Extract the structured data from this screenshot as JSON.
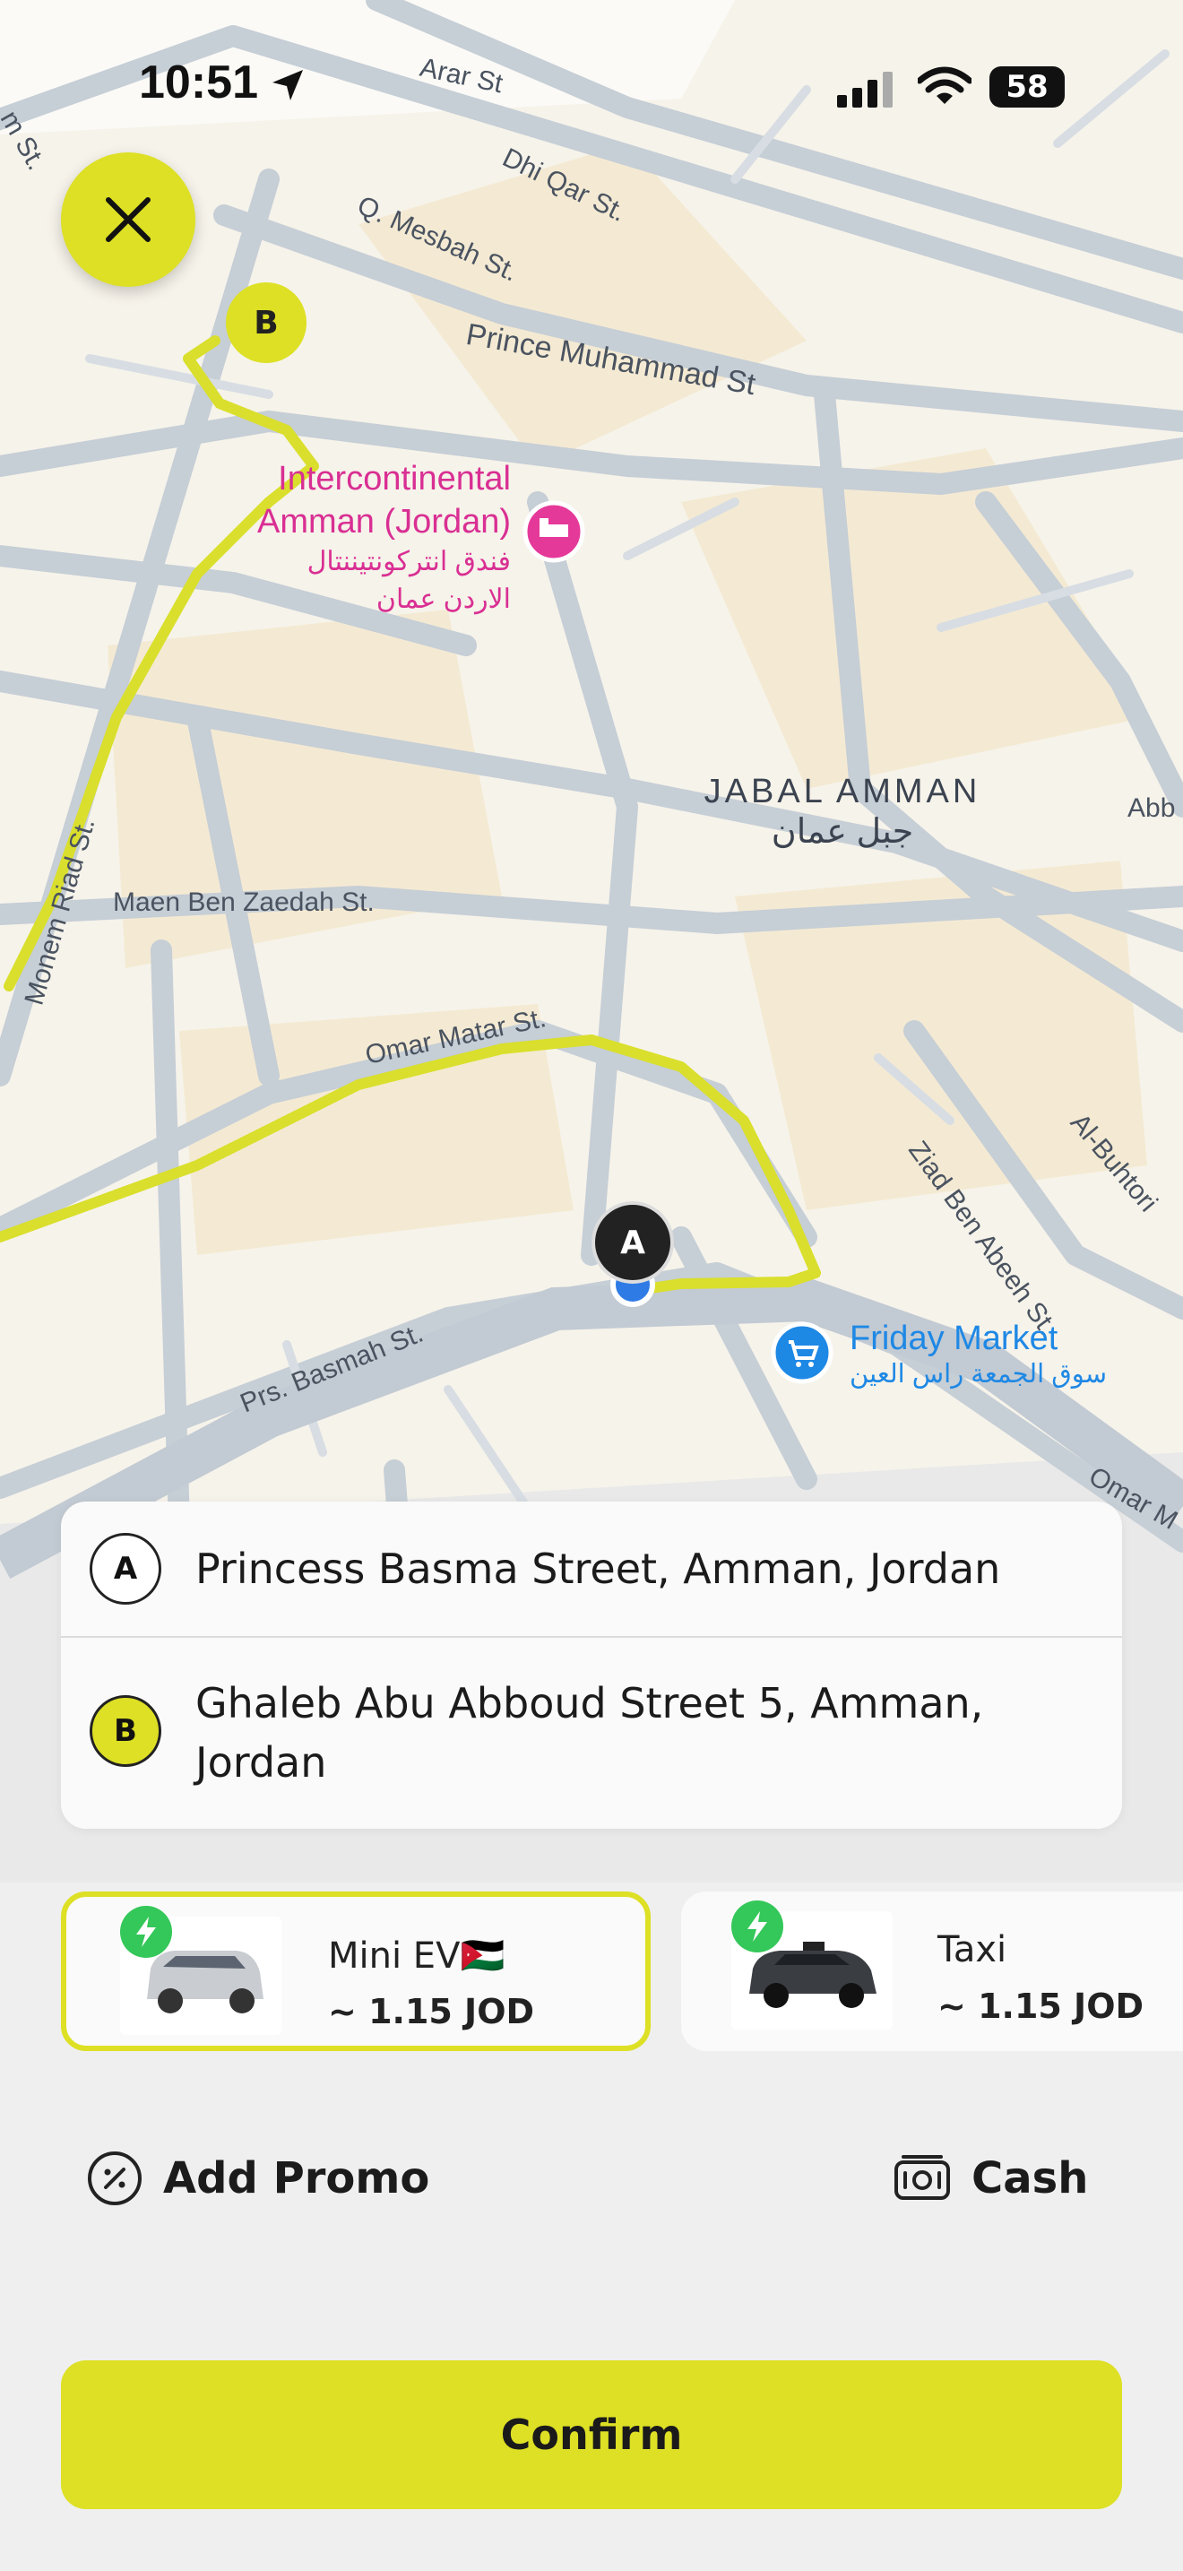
{
  "status_bar": {
    "time": "10:51",
    "battery": "58"
  },
  "map": {
    "streets": {
      "arar": "Arar St",
      "dhi_qar": "Dhi Qar St.",
      "q_mesbah": "Q. Mesbah St.",
      "prince_muhammad": "Prince Muhammad St",
      "monem_riad": "Monem Riad St.",
      "maen": "Maen Ben Zaedah St.",
      "omar_matar": "Omar Matar St.",
      "basmah": "Prs. Basmah St.",
      "ziad": "Ziad Ben Abeeh St.",
      "al_buhtori": "Al-Buhtori",
      "omar_m": "Omar M",
      "abb": "Abb",
      "m_st": "m St."
    },
    "hotel": {
      "line1": "Intercontinental",
      "line2": "Amman (Jordan)",
      "ar_line1": "فندق انتركونتيننتال",
      "ar_line2": "الاردن عمان"
    },
    "district": {
      "en": "JABAL AMMAN",
      "ar": "جبل عمان"
    },
    "market": {
      "en": "Friday Market",
      "ar": "سوق الجمعة راس العين"
    },
    "pin_a": "A",
    "pin_b": "B"
  },
  "route_card": {
    "pickup": {
      "marker": "A",
      "address": "Princess Basma Street, Amman, Jordan"
    },
    "dropoff": {
      "marker": "B",
      "address": "Ghaleb Abu Abboud Street 5, Amman, Jordan"
    }
  },
  "rides": [
    {
      "name": "Mini EV🇯🇴",
      "price": "~ 1.15 JOD",
      "selected": true
    },
    {
      "name": "Taxi",
      "price": "~ 1.15 JOD",
      "selected": false
    }
  ],
  "options": {
    "promo": "Add Promo",
    "payment": "Cash"
  },
  "confirm": "Confirm",
  "colors": {
    "accent": "#dde024",
    "route": "#d9df2c",
    "hotel_pin": "#e5399a",
    "market_pin": "#1e88e5",
    "bolt": "#34c759"
  }
}
